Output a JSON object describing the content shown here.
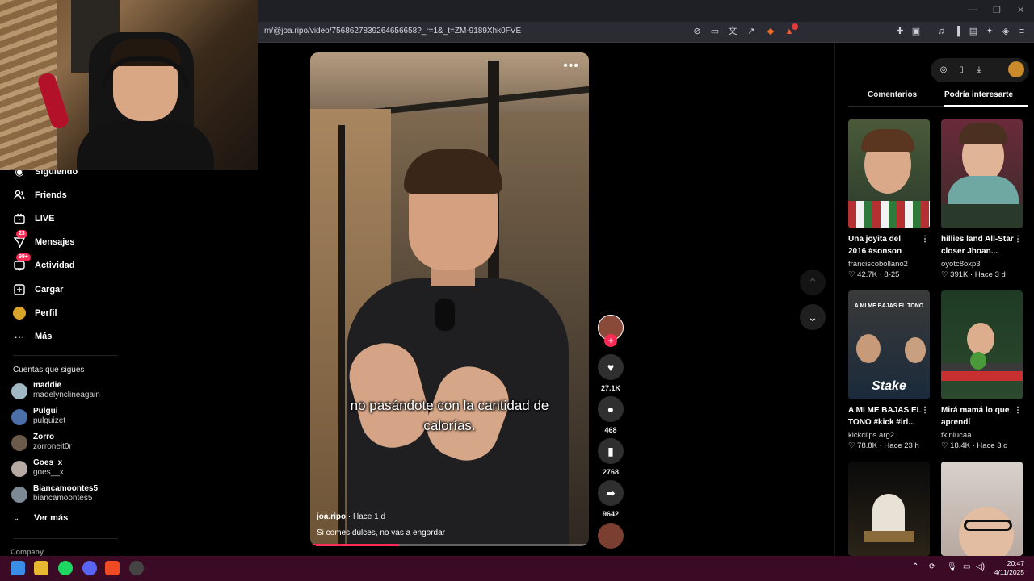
{
  "browser": {
    "url": "m/@joa.ripo/video/7568627839264656658?_r=1&_t=ZM-9189Xhk0FVE",
    "window_controls": [
      "—",
      "❐",
      "✕"
    ]
  },
  "sidebar": {
    "items": [
      {
        "label": "Siguiendo",
        "icon": "following-icon"
      },
      {
        "label": "Friends",
        "icon": "friends-icon"
      },
      {
        "label": "LIVE",
        "icon": "live-icon"
      },
      {
        "label": "Mensajes",
        "icon": "messages-icon",
        "badge": "23"
      },
      {
        "label": "Actividad",
        "icon": "activity-icon",
        "badge": "99+"
      },
      {
        "label": "Cargar",
        "icon": "upload-icon"
      },
      {
        "label": "Perfil",
        "icon": "profile-icon"
      },
      {
        "label": "Más",
        "icon": "more-icon"
      }
    ],
    "following_title": "Cuentas que sigues",
    "accounts": [
      {
        "name": "maddie",
        "handle": "madelynclineagain",
        "color": "#9fb8c4"
      },
      {
        "name": "Pulgui",
        "handle": "pulguizet",
        "color": "#4b6fa8"
      },
      {
        "name": "Zorro",
        "handle": "zorroneit0r",
        "color": "#6b5a4a"
      },
      {
        "name": "Goes_x",
        "handle": "goes__x",
        "color": "#b7a9a3"
      },
      {
        "name": "Biancamoontes5",
        "handle": "biancamoontes5",
        "color": "#7d8a95"
      }
    ],
    "see_more": "Ver más",
    "company": "Company"
  },
  "video": {
    "caption_line1": "no pasándote con la cantidad de",
    "caption_line2": "calorías.",
    "author": "joa.ripo",
    "time": "· Hace 1 d",
    "description": "Si comes dulces, no vas a engordar",
    "more": "•••",
    "progress": 0.32
  },
  "actions": {
    "likes": "27.1K",
    "comments": "468",
    "saves": "2768",
    "shares": "9642"
  },
  "right_panel": {
    "tab_comments": "Comentarios",
    "tab_suggested": "Podría interesarte",
    "cards": [
      {
        "title_line1": "Una joyita del",
        "title_line2": "2016 #sonson",
        "user": "franciscobollano2",
        "likes": "♡ 42.7K",
        "date": "· 8-25"
      },
      {
        "title_line1": "hillies land All-Star",
        "title_line2": "closer Jhoan...",
        "user": "oyotc8oxp3",
        "likes": "♡ 391K",
        "date": "· Hace 3 d"
      },
      {
        "title_line1": "A MI ME BAJAS EL",
        "title_line2": "TONO #kick #irl...",
        "user": "kickclips.arg2",
        "likes": "♡ 78.8K",
        "date": "· Hace 23 h",
        "overlay": "A MI ME BAJAS EL TONO",
        "brand": "Stake"
      },
      {
        "title_line1": "Mirá mamá lo que",
        "title_line2": "aprendí",
        "user": "fkinlucaa",
        "likes": "♡ 18.4K",
        "date": "· Hace 3 d"
      }
    ]
  },
  "taskbar": {
    "time": "20:47",
    "date": "4/11/2025"
  }
}
